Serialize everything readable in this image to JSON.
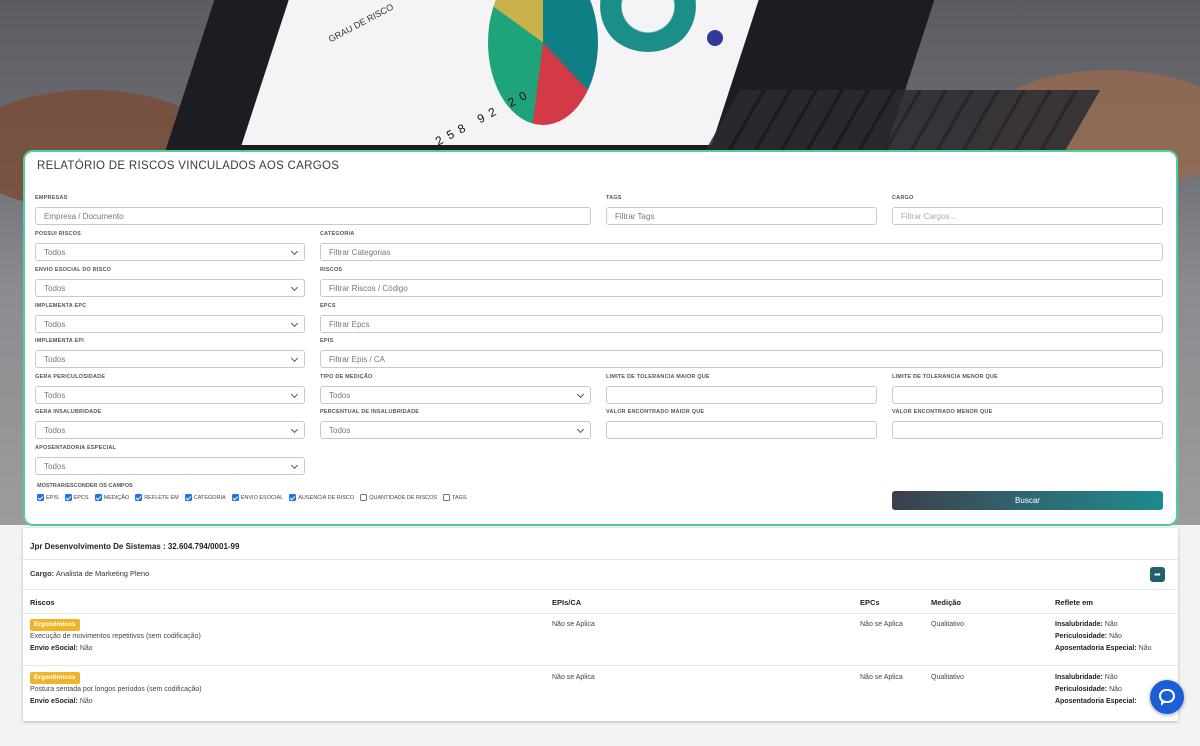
{
  "background": {
    "screen_title": "GRAU DE RISCO",
    "screen_numbers": "258 92 20"
  },
  "panel": {
    "title": "RELATÓRIO DE RISCOS VINCULADOS AOS CARGOS",
    "fields": {
      "empresas": {
        "label": "EMPRESAS",
        "placeholder": "Empresa / Documento"
      },
      "tags": {
        "label": "TAGS",
        "placeholder": "Filtrar Tags"
      },
      "cargo": {
        "label": "CARGO",
        "placeholder": "Filtrar Cargos..."
      },
      "possui_riscos": {
        "label": "POSSUI RISCOS",
        "value": "Todos"
      },
      "categoria": {
        "label": "CATEGORIA",
        "placeholder": "Filtrar Categorias"
      },
      "envio_esocial": {
        "label": "ENVIO ESOCIAL DO RISCO",
        "value": "Todos"
      },
      "riscos": {
        "label": "RISCOS",
        "placeholder": "Filtrar Riscos / Código"
      },
      "implementa_epc": {
        "label": "IMPLEMENTA EPC",
        "value": "Todos"
      },
      "epcs": {
        "label": "EPCS",
        "placeholder": "Filtrar Epcs"
      },
      "implementa_epi": {
        "label": "IMPLEMENTA EPI",
        "value": "Todos"
      },
      "epis": {
        "label": "EPIS",
        "placeholder": "Filtrar Epis / CA"
      },
      "gera_periculosidade": {
        "label": "GERA PERICULOSIDADE",
        "value": "Todos"
      },
      "tipo_medicao": {
        "label": "TIPO DE MEDIÇÃO",
        "value": "Todos"
      },
      "limite_maior": {
        "label": "LIMITE DE TOLERANCIA MAIOR QUE",
        "value": ""
      },
      "limite_menor": {
        "label": "LIMITE DE TOLERANCIA MENOR QUE",
        "value": ""
      },
      "gera_insalubridade": {
        "label": "GERA INSALUBRIDADE",
        "value": "Todos"
      },
      "percentual_insalubridade": {
        "label": "PERCENTUAL DE INSALUBRIDADE",
        "value": "Todos"
      },
      "valor_maior": {
        "label": "VALOR ENCONTRADO MAIOR QUE",
        "value": ""
      },
      "valor_menor": {
        "label": "VALOR ENCONTRADO MENOR QUE",
        "value": ""
      },
      "aposentadoria_especial": {
        "label": "APOSENTADORIA ESPECIAL",
        "value": "Todos"
      }
    },
    "toggle_label": "MOSTRAR/ESCONDER OS CAMPOS",
    "toggles": [
      {
        "label": "EPIS",
        "checked": true
      },
      {
        "label": "EPCS",
        "checked": true
      },
      {
        "label": "MEDIÇÃO",
        "checked": true
      },
      {
        "label": "REFLETE EM",
        "checked": true
      },
      {
        "label": "CATEGORIA",
        "checked": true
      },
      {
        "label": "ENVIO ESOCIAL",
        "checked": true
      },
      {
        "label": "AUSENCIA DE RISCO",
        "checked": true
      },
      {
        "label": "QUANTIDADE DE RISCOS",
        "checked": false
      },
      {
        "label": "TAGS",
        "checked": false
      }
    ],
    "search_button": "Buscar"
  },
  "results": {
    "company": "Jpr Desenvolvimento De Sistemas : 32.604.794/0001-99",
    "cargo_label": "Cargo:",
    "cargo_value": "Analista de Marketing Pleno",
    "headers": {
      "riscos": "Riscos",
      "epis": "EPIs/CA",
      "epcs": "EPCs",
      "medicao": "Medição",
      "reflete": "Reflete em"
    },
    "rows": [
      {
        "category": "Ergonômicos",
        "risk": "Execução de movimentos repetitivos (sem codificação)",
        "esocial_label": "Envio eSocial:",
        "esocial_value": "Não",
        "epis": "Não se Aplica",
        "epcs": "Não se Aplica",
        "medicao": "Qualitativo",
        "insal_label": "Insalubridade:",
        "insal_value": "Não",
        "peric_label": "Periculosidade:",
        "peric_value": "Não",
        "apos_label": "Aposentadoria Especial:",
        "apos_value": "Não"
      },
      {
        "category": "Ergonômicos",
        "risk": "Postura sentada por longos períodos (sem codificação)",
        "esocial_label": "Envio eSocial:",
        "esocial_value": "Não",
        "epis": "Não se Aplica",
        "epcs": "Não se Aplica",
        "medicao": "Qualitativo",
        "insal_label": "Insalubridade:",
        "insal_value": "Não",
        "peric_label": "Periculosidade:",
        "peric_value": "Não",
        "apos_label": "Aposentadoria Especial:",
        "apos_value": ""
      }
    ]
  },
  "icons": {
    "share": "share-icon",
    "chat": "chat-icon"
  },
  "colors": {
    "panel_border": "#4cd19b",
    "tag": "#f0b429",
    "checkbox": "#1a73e8",
    "chat": "#1a5fd6"
  }
}
